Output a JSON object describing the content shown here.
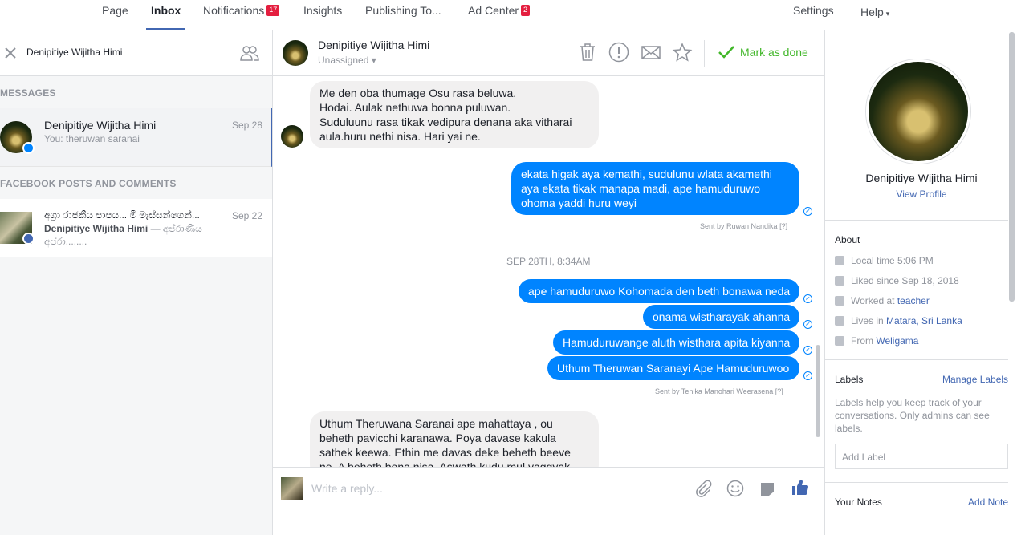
{
  "topnav": {
    "page": "Page",
    "inbox": "Inbox",
    "notifications": "Notifications",
    "notifications_count": "17",
    "insights": "Insights",
    "publishing": "Publishing To...",
    "ad_center": "Ad Center",
    "ad_center_count": "2",
    "settings": "Settings",
    "help": "Help"
  },
  "left": {
    "search_value": "Denipitiye Wijitha Himi",
    "messages_header": "MESSAGES",
    "posts_header": "FACEBOOK POSTS AND COMMENTS",
    "threads": [
      {
        "name": "Denipitiye Wijitha Himi",
        "date": "Sep 28",
        "snippet": "You: theruwan saranai"
      },
      {
        "name": "අග්‍රා රාජකීය පාපය... මී මැස්සන්ගෙන්...",
        "date": "Sep 22",
        "author": "Denipitiye Wijitha Himi",
        "snippet_1": " — අප්රාණිය",
        "snippet_2": "අප්රා........"
      }
    ]
  },
  "chat": {
    "name": "Denipitiye Wijitha Himi",
    "assignee": "Unassigned",
    "mark_done": "Mark as done",
    "messages": [
      {
        "lines": [
          "Me den oba thumage Osu rasa beluwa.",
          "Hodai. Aulak nethuwa bonna puluwan.",
          "Suduluunu rasa tikak vedipura denana aka vitharai",
          "aula.huru nethi nisa. Hari yai ne."
        ]
      },
      {
        "lines": [
          "ekata higak aya kemathi, sudulunu wlata akamethi",
          "aya ekata tikak manapa madi, ape hamuduruwo",
          "ohoma yaddi huru weyi"
        ]
      },
      {
        "sent_by": "Sent by Ruwan Nandika",
        "help": "[?]"
      },
      {
        "divider": "SEP 28TH, 8:34AM"
      },
      {
        "text": "ape hamuduruwo Kohomada den beth bonawa neda"
      },
      {
        "text": "onama wistharayak ahanna"
      },
      {
        "text": "Hamuduruwange aluth wisthara apita kiyanna"
      },
      {
        "text": "Uthum Theruwan Saranayi Ape Hamuduruwoo"
      },
      {
        "sent_by": "Sent by Tenika Manohari Weerasena",
        "help": "[?]"
      },
      {
        "lines": [
          "Uthum Theruwana Saranai ape mahattaya , ou",
          "beheth pavicchi karanawa. Poya davase kakula",
          "sathek keewa. Ethin me davas deke beheth beeve",
          "ne. A beheth bona nisa. Aswath kudu mul yaggyak"
        ]
      }
    ],
    "reply_placeholder": "Write a reply..."
  },
  "right": {
    "name": "Denipitiye Wijitha Himi",
    "view_profile": "View Profile",
    "about_header": "About",
    "local_time": "Local time 5:06 PM",
    "liked_since": "Liked since Sep 18, 2018",
    "worked_at_prefix": "Worked at ",
    "worked_at": "teacher",
    "lives_in_prefix": "Lives in ",
    "lives_in": "Matara, Sri Lanka",
    "from_prefix": "From ",
    "from": "Weligama",
    "labels_header": "Labels",
    "manage_labels": "Manage Labels",
    "labels_help": [
      "Labels help you keep track of your",
      "conversations. Only admins can see",
      "labels."
    ],
    "add_label_placeholder": "Add Label",
    "notes_header": "Your Notes",
    "add_note": "Add Note"
  },
  "icons": {
    "close": "close-icon",
    "people": "people-icon",
    "trash": "trash-icon",
    "spam": "exclamation-icon",
    "mail": "mail-icon",
    "star": "star-icon",
    "check": "check-icon",
    "attach": "paperclip-icon",
    "emoji": "smiley-icon",
    "sticker": "sticker-icon",
    "like": "thumbs-up-icon"
  },
  "colors": {
    "accent": "#4267b2",
    "messenger_blue": "#0084ff",
    "done_green": "#42b72a",
    "badge_red": "#e41e3f"
  }
}
